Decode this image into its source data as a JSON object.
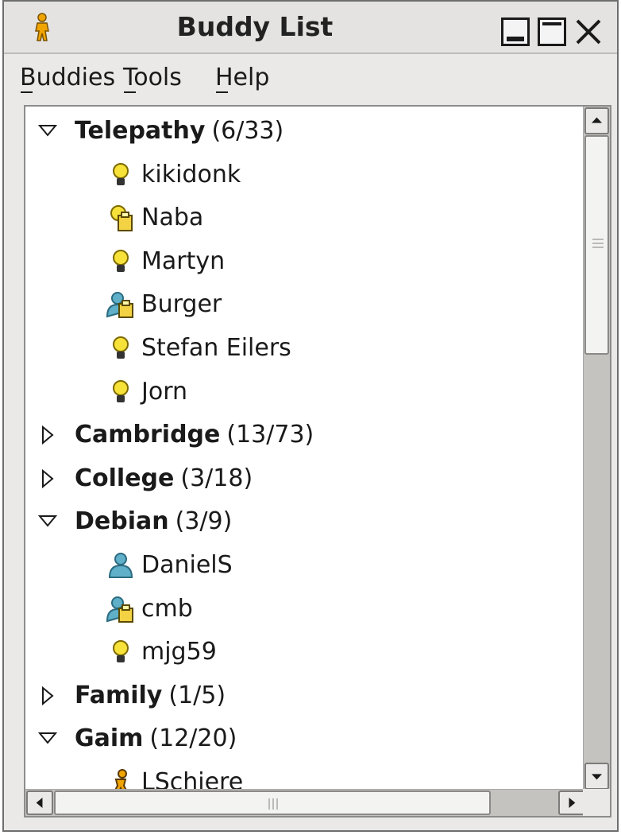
{
  "window": {
    "title": "Buddy List"
  },
  "menu": {
    "buddies": "Buddies",
    "tools": "Tools",
    "help": "Help"
  },
  "groups": [
    {
      "name": "Telepathy",
      "count": "(6/33)",
      "expanded": true,
      "buddies": [
        {
          "name": "kikidonk",
          "icon": "lightbulb-icon"
        },
        {
          "name": "Naba",
          "icon": "away-bulb-icon"
        },
        {
          "name": "Martyn",
          "icon": "lightbulb-icon"
        },
        {
          "name": "Burger",
          "icon": "away-person-icon"
        },
        {
          "name": "Stefan Eilers",
          "icon": "lightbulb-icon"
        },
        {
          "name": "Jorn",
          "icon": "lightbulb-icon"
        }
      ]
    },
    {
      "name": "Cambridge",
      "count": "(13/73)",
      "expanded": false,
      "buddies": []
    },
    {
      "name": "College",
      "count": "(3/18)",
      "expanded": false,
      "buddies": []
    },
    {
      "name": "Debian",
      "count": "(3/9)",
      "expanded": true,
      "buddies": [
        {
          "name": "DanielS",
          "icon": "person-icon"
        },
        {
          "name": "cmb",
          "icon": "away-person-icon"
        },
        {
          "name": "mjg59",
          "icon": "lightbulb-icon"
        }
      ]
    },
    {
      "name": "Family",
      "count": "(1/5)",
      "expanded": false,
      "buddies": []
    },
    {
      "name": "Gaim",
      "count": "(12/20)",
      "expanded": true,
      "buddies": [
        {
          "name": "LSchiere",
          "icon": "aim-running-man-icon"
        }
      ]
    }
  ]
}
